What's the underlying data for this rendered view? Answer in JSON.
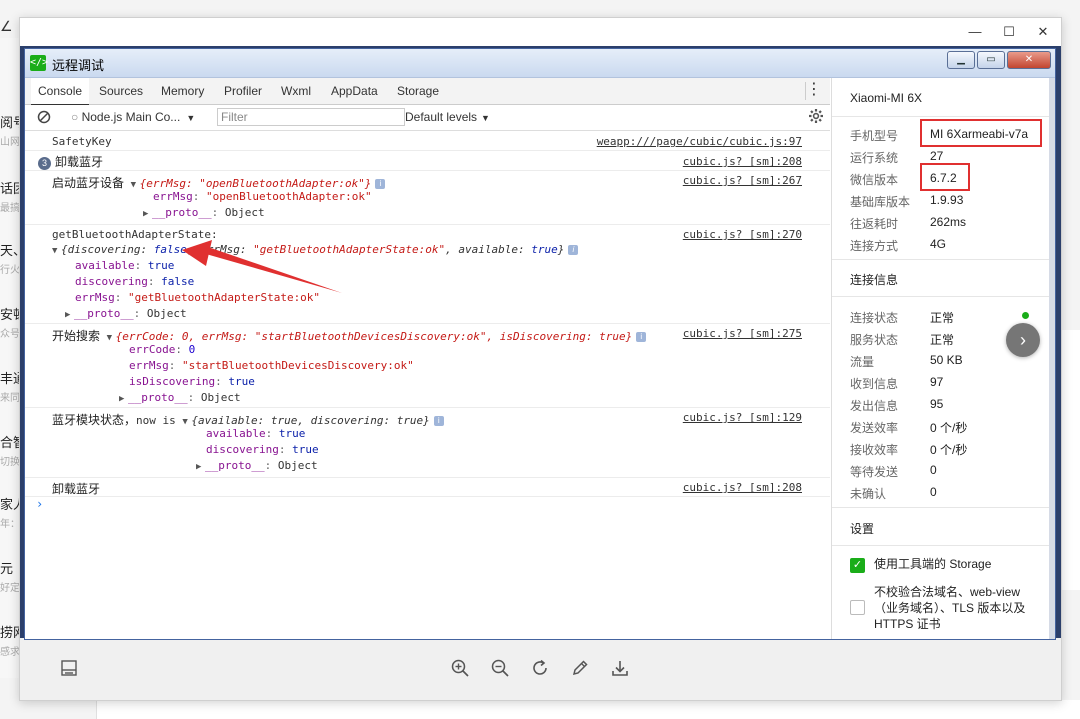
{
  "background": {
    "items": [
      {
        "title": "阅号",
        "sub": "山网"
      },
      {
        "title": "话团",
        "sub": "最搞"
      },
      {
        "title": "天、",
        "sub": "行火"
      },
      {
        "title": "安顿",
        "sub": "众号"
      },
      {
        "title": "丰通",
        "sub": "来同"
      },
      {
        "title": "合智",
        "sub": "切换"
      },
      {
        "title": "家人",
        "sub": "年："
      },
      {
        "title": "元",
        "sub": "好定"
      },
      {
        "title": "捞网",
        "sub": "感求"
      }
    ]
  },
  "outer_window": {
    "controls": {
      "minimize": "—",
      "maximize": "☐",
      "close": "✕"
    }
  },
  "inner_window": {
    "title": "远程调试",
    "logo": "</>"
  },
  "devtools": {
    "tabs": [
      "Console",
      "Sources",
      "Memory",
      "Profiler",
      "Wxml",
      "AppData",
      "Storage"
    ],
    "active_tab": "Console",
    "context": "Node.js Main Co...",
    "filter_placeholder": "Filter",
    "levels": "Default levels"
  },
  "console": {
    "m1": {
      "text": "SafetyKey",
      "src": "weapp:///page/cubic/cubic.js:97"
    },
    "m2": {
      "count": "3",
      "text": "卸载蓝牙",
      "src": "cubic.js? [sm]:208"
    },
    "m3": {
      "label": "启动蓝牙设备",
      "summary": "{errMsg: \"openBluetoothAdapter:ok\"}",
      "src": "cubic.js? [sm]:267",
      "errMsg_key": "errMsg",
      "errMsg_val": "\"openBluetoothAdapter:ok\"",
      "proto": "__proto__",
      "proto_val": "Object"
    },
    "m4": {
      "label": "getBluetoothAdapterState:",
      "summary_pre": "{discovering: ",
      "summary_false": "false",
      "summary_mid": ", errMsg: ",
      "summary_str": "\"getBluetoothAdapterState:ok\"",
      "summary_post": ", available: ",
      "summary_true": "true",
      "summary_end": "}",
      "src": "cubic.js? [sm]:270",
      "available_key": "available",
      "available_val": "true",
      "discovering_key": "discovering",
      "discovering_val": "false",
      "errMsg_key": "errMsg",
      "errMsg_val": "\"getBluetoothAdapterState:ok\"",
      "proto": "__proto__",
      "proto_val": "Object"
    },
    "m5": {
      "label": "开始搜索",
      "summary": "{errCode: 0, errMsg: \"startBluetoothDevicesDiscovery:ok\", isDiscovering: true}",
      "src": "cubic.js? [sm]:275",
      "errCode_key": "errCode",
      "errCode_val": "0",
      "errMsg_key": "errMsg",
      "errMsg_val": "\"startBluetoothDevicesDiscovery:ok\"",
      "isDiscovering_key": "isDiscovering",
      "isDiscovering_val": "true",
      "proto": "__proto__",
      "proto_val": "Object"
    },
    "m6": {
      "label": "蓝牙模块状态，",
      "label2": "now is",
      "summary": "{available: true, discovering: true}",
      "src": "cubic.js? [sm]:129",
      "available_key": "available",
      "available_val": "true",
      "discovering_key": "discovering",
      "discovering_val": "true",
      "proto": "__proto__",
      "proto_val": "Object"
    },
    "m7": {
      "text": "卸载蓝牙",
      "src": "cubic.js? [sm]:208"
    },
    "prompt": "›"
  },
  "device_panel": {
    "device_title": "Xiaomi-MI 6X",
    "info": [
      {
        "label": "手机型号",
        "value": "MI 6Xarmeabi-v7a"
      },
      {
        "label": "运行系统",
        "value": "27"
      },
      {
        "label": "微信版本",
        "value": "6.7.2"
      },
      {
        "label": "基础库版本",
        "value": "1.9.93"
      },
      {
        "label": "往返耗时",
        "value": "262ms"
      },
      {
        "label": "连接方式",
        "value": "4G"
      }
    ],
    "conn_title": "连接信息",
    "conn": [
      {
        "label": "连接状态",
        "value": "正常"
      },
      {
        "label": "服务状态",
        "value": "正常"
      },
      {
        "label": "流量",
        "value": "50 KB"
      },
      {
        "label": "收到信息",
        "value": "97"
      },
      {
        "label": "发出信息",
        "value": "95"
      },
      {
        "label": "发送效率",
        "value": "0 个/秒"
      },
      {
        "label": "接收效率",
        "value": "0 个/秒"
      },
      {
        "label": "等待发送",
        "value": "0"
      },
      {
        "label": "未确认",
        "value": "0"
      }
    ],
    "fab": "›",
    "settings_title": "设置",
    "settings": [
      {
        "label": "使用工具端的 Storage",
        "checked": true
      },
      {
        "label": "不校验合法域名、web-view（业务域名）、TLS 版本以及 HTTPS 证书",
        "checked": false
      }
    ]
  },
  "toolbar": {
    "icons": [
      "layout-icon",
      "zoom-in-icon",
      "zoom-out-icon",
      "refresh-icon",
      "edit-icon",
      "download-icon"
    ]
  },
  "annotation_color": "#e03030",
  "status_color": "#1aad19"
}
